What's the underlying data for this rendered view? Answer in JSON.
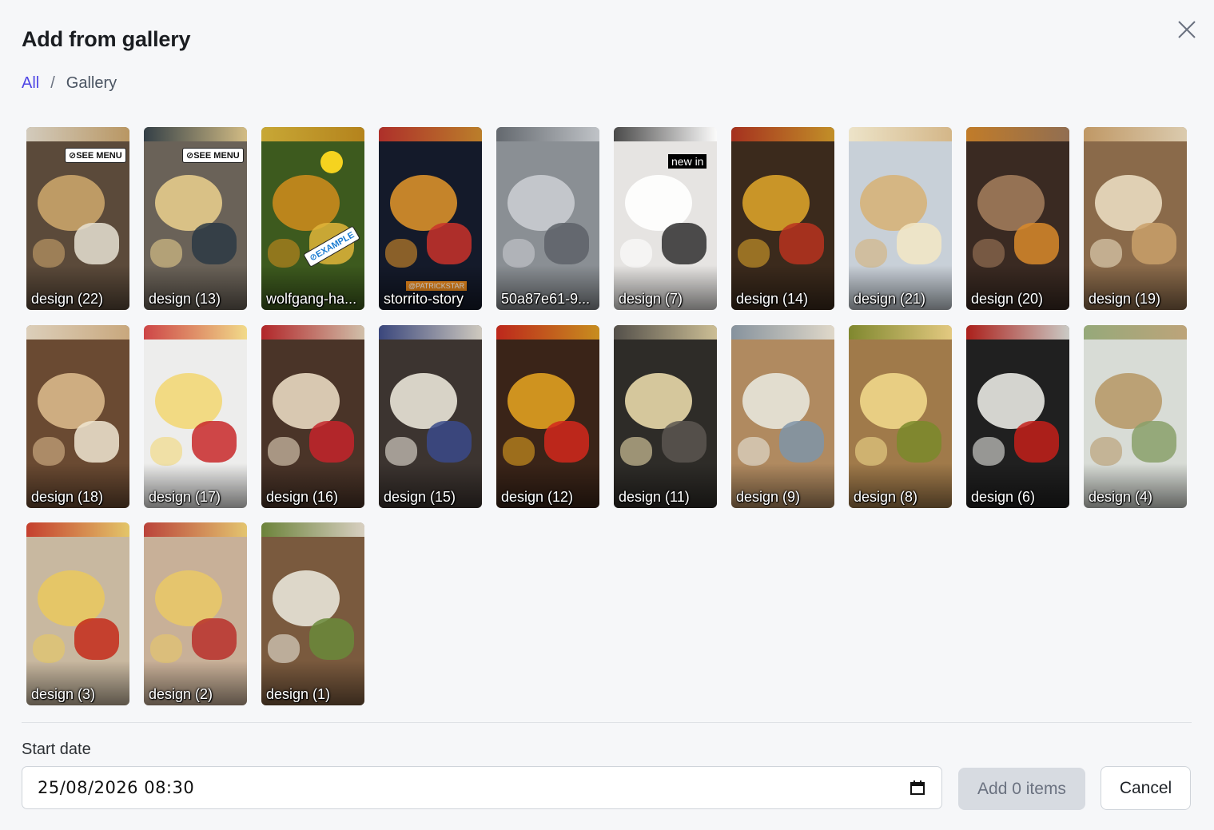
{
  "dialog": {
    "title": "Add from gallery",
    "close_icon": "close-icon"
  },
  "breadcrumb": {
    "root": "All",
    "separator": "/",
    "current": "Gallery"
  },
  "gallery": {
    "items": [
      {
        "label": "design (22)",
        "bg": "#5b4a3a",
        "accent": "#c9a46a",
        "accent2": "#e8e2d4",
        "overlay": {
          "kind": "badge",
          "text": "⊘SEE MENU"
        }
      },
      {
        "label": "design (13)",
        "bg": "#6a6258",
        "accent": "#e5cc8c",
        "accent2": "#2b3a44",
        "overlay": {
          "kind": "badge",
          "text": "⊘SEE MENU"
        }
      },
      {
        "label": "wolfgang-ha...",
        "bg": "#3d5a1e",
        "accent": "#c98a1c",
        "accent2": "#e0b53a",
        "overlay": {
          "kind": "example",
          "text": "⊘EXAMPLE"
        }
      },
      {
        "label": "storrito-story",
        "bg": "#141a2a",
        "accent": "#d8902a",
        "accent2": "#c9332a",
        "overlay": {
          "kind": "tag",
          "text": "@PATRICKSTAR"
        }
      },
      {
        "label": "50a87e61-9...",
        "bg": "#8a8f94",
        "accent": "#c9ccd0",
        "accent2": "#5d6268",
        "overlay": null
      },
      {
        "label": "design (7)",
        "bg": "#e6e4e2",
        "accent": "#ffffff",
        "accent2": "#2f2f2f",
        "overlay": {
          "kind": "dark",
          "text": "new in"
        }
      },
      {
        "label": "design (14)",
        "bg": "#3b2a1c",
        "accent": "#d9a12a",
        "accent2": "#b8321f",
        "overlay": null
      },
      {
        "label": "design (21)",
        "bg": "#c8d0d8",
        "accent": "#d6b27a",
        "accent2": "#f3e7c6",
        "overlay": null
      },
      {
        "label": "design (20)",
        "bg": "#3a2a22",
        "accent": "#a07a5a",
        "accent2": "#d98a2a",
        "overlay": null
      },
      {
        "label": "design (19)",
        "bg": "#8a6a4a",
        "accent": "#e9dcc0",
        "accent2": "#c9a06a",
        "overlay": null
      },
      {
        "label": "design (18)",
        "bg": "#6a4a32",
        "accent": "#d9b88a",
        "accent2": "#f0e6d2",
        "overlay": null
      },
      {
        "label": "design (17)",
        "bg": "#ededec",
        "accent": "#f2d778",
        "accent2": "#c8282a",
        "overlay": null
      },
      {
        "label": "design (16)",
        "bg": "#4a3428",
        "accent": "#e8d8c0",
        "accent2": "#c4242a",
        "overlay": null
      },
      {
        "label": "design (15)",
        "bg": "#3c3430",
        "accent": "#e9e4d8",
        "accent2": "#3a4a8a",
        "overlay": null
      },
      {
        "label": "design (12)",
        "bg": "#3a2418",
        "accent": "#e0a020",
        "accent2": "#d4281c",
        "overlay": null
      },
      {
        "label": "design (11)",
        "bg": "#2e2c28",
        "accent": "#e8d8a8",
        "accent2": "#5a5650",
        "overlay": null
      },
      {
        "label": "design (9)",
        "bg": "#b08a60",
        "accent": "#e8e6dc",
        "accent2": "#7f94a8",
        "overlay": null
      },
      {
        "label": "design (8)",
        "bg": "#a07a4a",
        "accent": "#efd78a",
        "accent2": "#7a8a2a",
        "overlay": null
      },
      {
        "label": "design (6)",
        "bg": "#202020",
        "accent": "#e8e8e2",
        "accent2": "#c4201a",
        "overlay": null
      },
      {
        "label": "design (4)",
        "bg": "#d8dcd6",
        "accent": "#b89a6a",
        "accent2": "#8aa06a",
        "overlay": null
      },
      {
        "label": "design (3)",
        "bg": "#c8b8a0",
        "accent": "#e8c860",
        "accent2": "#c42a1a",
        "overlay": null
      },
      {
        "label": "design (2)",
        "bg": "#c8b098",
        "accent": "#e8c868",
        "accent2": "#b8302a",
        "overlay": null
      },
      {
        "label": "design (1)",
        "bg": "#7a5a3e",
        "accent": "#e8e4d8",
        "accent2": "#6a8a3a",
        "overlay": null
      }
    ]
  },
  "footer": {
    "start_date_label": "Start date",
    "start_date_value": "25/08/2026  08:30",
    "add_button": "Add 0 items",
    "cancel_button": "Cancel",
    "calendar_icon": "calendar-icon"
  }
}
